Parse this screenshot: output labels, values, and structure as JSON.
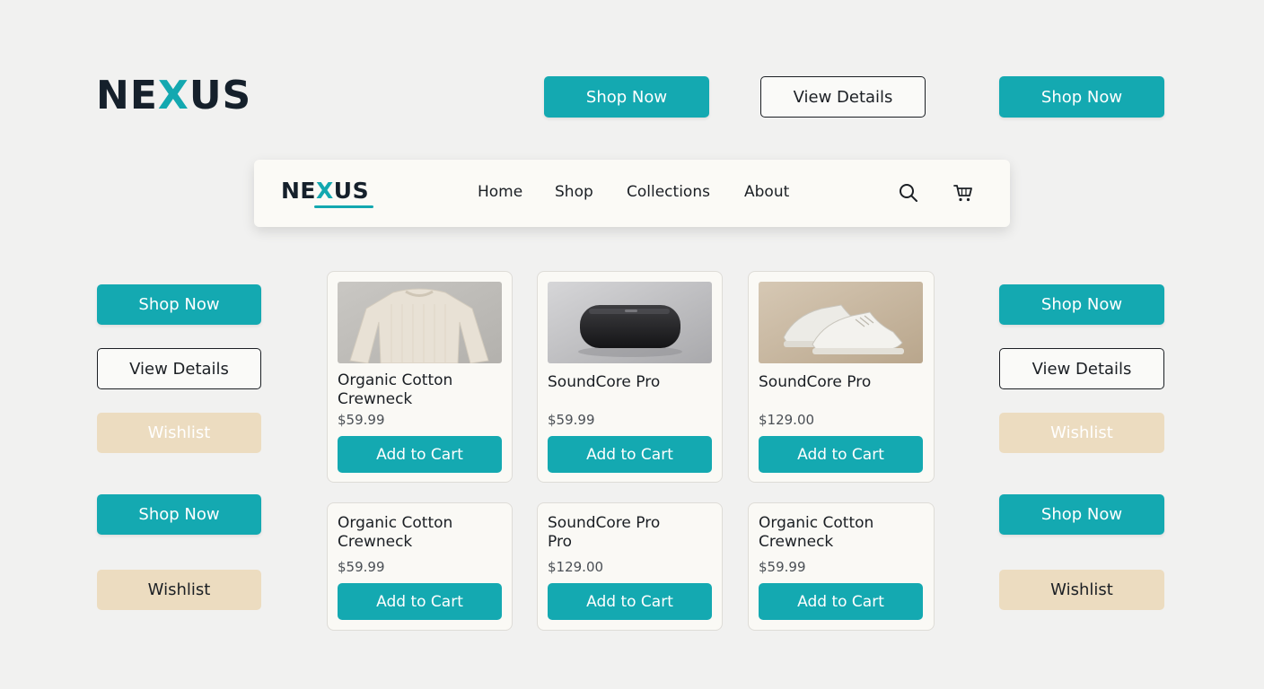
{
  "brand": {
    "logo_prefix": "NE",
    "logo_accent": "X",
    "logo_suffix": "US",
    "accent_color": "#14a9b1",
    "dark_color": "#15202b",
    "wishlist_color": "#ecdcc0"
  },
  "top_buttons": {
    "shop_now_1": "Shop Now",
    "view_details": "View Details",
    "shop_now_2": "Shop Now"
  },
  "nav": {
    "items": [
      "Home",
      "Shop",
      "Collections",
      "About"
    ],
    "search_icon": "search-icon",
    "cart_icon": "cart-icon"
  },
  "left_buttons": {
    "shop_now_1": "Shop Now",
    "view_details": "View Details",
    "wishlist_disabled": "Wishlist",
    "shop_now_2": "Shop Now",
    "wishlist": "Wishlist"
  },
  "right_buttons": {
    "shop_now_1": "Shop Now",
    "view_details": "View Details",
    "wishlist_disabled": "Wishlist",
    "shop_now_2": "Shop Now",
    "wishlist": "Wishlist"
  },
  "products": [
    {
      "name_line1": "Organic Cotton",
      "name_line2": "Crewneck",
      "price": "$59.99",
      "cta": "Add to Cart",
      "image": "sweater-image"
    },
    {
      "name_line1": "SoundCore Pro",
      "name_line2": "",
      "price": "$59.99",
      "cta": "Add to Cart",
      "image": "speaker-image"
    },
    {
      "name_line1": "SoundCore Pro",
      "name_line2": "",
      "price": "$129.00",
      "cta": "Add to Cart",
      "image": "sneakers-image"
    },
    {
      "name_line1": "Organic Cotton",
      "name_line2": "Crewneck",
      "price": "$59.99",
      "cta": "Add to Cart"
    },
    {
      "name_line1": "SoundCore Pro",
      "name_line2": "Pro",
      "price": "$129.00",
      "cta": "Add to Cart"
    },
    {
      "name_line1": "Organic Cotton",
      "name_line2": "Crewneck",
      "price": "$59.99",
      "cta": "Add to Cart"
    }
  ]
}
